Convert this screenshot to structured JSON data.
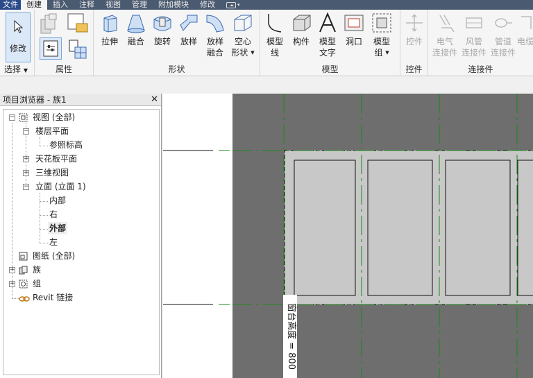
{
  "tabs": [
    "文件",
    "创建",
    "插入",
    "注释",
    "视图",
    "管理",
    "附加模块",
    "修改"
  ],
  "ribbon": {
    "select_panel": {
      "label": "选择",
      "modify": "修改"
    },
    "properties_panel": {
      "label": "属性"
    },
    "shape_panel": {
      "label": "形状",
      "tools": [
        "拉伸",
        "融合",
        "旋转",
        "放样",
        "放样\n融合",
        "空心\n形状"
      ]
    },
    "model_panel": {
      "label": "模型",
      "tools": [
        "模型\n线",
        "构件",
        "模型\n文字",
        "洞口",
        "模型\n组"
      ]
    },
    "control_panel": {
      "label": "控件",
      "tools": [
        "控件"
      ]
    },
    "connector_panel": {
      "label": "连接件",
      "tools": [
        "电气\n连接件",
        "风管\n连接件",
        "管道\n连接件",
        "电缆"
      ]
    }
  },
  "browser": {
    "title": "项目浏览器 - 族1",
    "close": "✕",
    "nodes": {
      "views": "视图 (全部)",
      "floor_plans": "楼层平面",
      "ref_level": "参照标高",
      "ceiling_plans": "天花板平面",
      "3d_views": "三维视图",
      "elevations": "立面 (立面 1)",
      "interior": "内部",
      "right": "右",
      "exterior": "外部",
      "left": "左",
      "sheets": "图纸 (全部)",
      "families": "族",
      "groups": "组",
      "revit_links": "Revit 链接"
    }
  },
  "canvas": {
    "dimension_label": "窗台高度 = 800"
  },
  "colors": {
    "canvas_bg": "#6e6e6e",
    "panel_fill": "#c8c8c8",
    "ref_plane": "#1a8a1a",
    "accent": "#2a4a8a"
  }
}
